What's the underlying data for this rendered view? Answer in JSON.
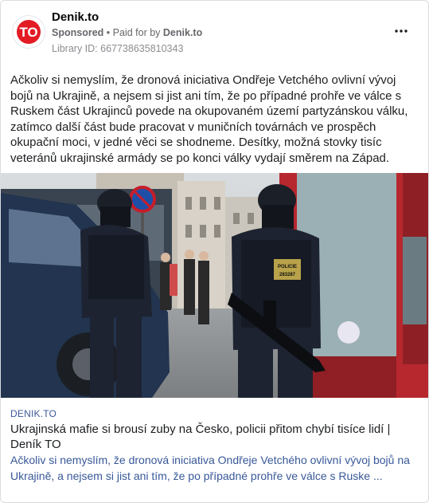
{
  "ad": {
    "page_name": "Denik.to",
    "sponsored_label": "Sponsored",
    "separator": "•",
    "paid_for_prefix": "Paid for by",
    "paid_for_name": "Denik.to",
    "library_id": "Library ID: 667738635810343",
    "avatar_text": "TO",
    "brand_color": "#e31b23"
  },
  "post": {
    "text": "Ačkoliv si nemyslím, že dronová iniciativa Ondřeje Vetchého ovlivní vývoj bojů na Ukrajině, a nejsem si jist ani tím, že po případné prohře ve válce s Ruskem část Ukrajinců povede na okupovaném území partyzánskou válku, zatímco další část bude pracovat v muničních továrnách ve prospěch okupační moci, v jedné věci se shodneme. Desítky, možná stovky tisíc veteránů ukrajinské armády se po konci války vydají směrem na Západ."
  },
  "photo": {
    "badge_line1": "POLICIE",
    "badge_line2": "283287"
  },
  "link": {
    "domain": "DENIK.TO",
    "title": "Ukrajinská mafie si brousí zuby na Česko, policii přitom chybí tisíce lidí | Deník TO",
    "description": "Ačkoliv si nemyslím, že dronová iniciativa Ondřeje Vetchého ovlivní vývoj bojů na Ukrajině, a nejsem si jist ani tím, že po případné prohře ve válce s Ruske ..."
  }
}
